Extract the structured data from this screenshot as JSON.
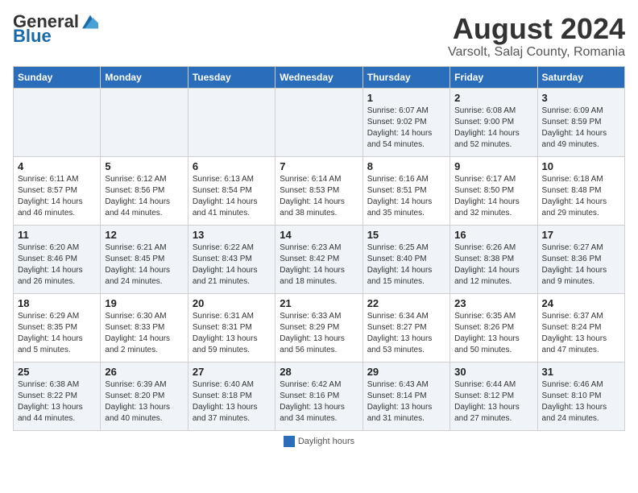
{
  "header": {
    "logo_general": "General",
    "logo_blue": "Blue",
    "main_title": "August 2024",
    "subtitle": "Varsolt, Salaj County, Romania"
  },
  "days_of_week": [
    "Sunday",
    "Monday",
    "Tuesday",
    "Wednesday",
    "Thursday",
    "Friday",
    "Saturday"
  ],
  "weeks": [
    [
      {
        "day": "",
        "info": ""
      },
      {
        "day": "",
        "info": ""
      },
      {
        "day": "",
        "info": ""
      },
      {
        "day": "",
        "info": ""
      },
      {
        "day": "1",
        "info": "Sunrise: 6:07 AM\nSunset: 9:02 PM\nDaylight: 14 hours\nand 54 minutes."
      },
      {
        "day": "2",
        "info": "Sunrise: 6:08 AM\nSunset: 9:00 PM\nDaylight: 14 hours\nand 52 minutes."
      },
      {
        "day": "3",
        "info": "Sunrise: 6:09 AM\nSunset: 8:59 PM\nDaylight: 14 hours\nand 49 minutes."
      }
    ],
    [
      {
        "day": "4",
        "info": "Sunrise: 6:11 AM\nSunset: 8:57 PM\nDaylight: 14 hours\nand 46 minutes."
      },
      {
        "day": "5",
        "info": "Sunrise: 6:12 AM\nSunset: 8:56 PM\nDaylight: 14 hours\nand 44 minutes."
      },
      {
        "day": "6",
        "info": "Sunrise: 6:13 AM\nSunset: 8:54 PM\nDaylight: 14 hours\nand 41 minutes."
      },
      {
        "day": "7",
        "info": "Sunrise: 6:14 AM\nSunset: 8:53 PM\nDaylight: 14 hours\nand 38 minutes."
      },
      {
        "day": "8",
        "info": "Sunrise: 6:16 AM\nSunset: 8:51 PM\nDaylight: 14 hours\nand 35 minutes."
      },
      {
        "day": "9",
        "info": "Sunrise: 6:17 AM\nSunset: 8:50 PM\nDaylight: 14 hours\nand 32 minutes."
      },
      {
        "day": "10",
        "info": "Sunrise: 6:18 AM\nSunset: 8:48 PM\nDaylight: 14 hours\nand 29 minutes."
      }
    ],
    [
      {
        "day": "11",
        "info": "Sunrise: 6:20 AM\nSunset: 8:46 PM\nDaylight: 14 hours\nand 26 minutes."
      },
      {
        "day": "12",
        "info": "Sunrise: 6:21 AM\nSunset: 8:45 PM\nDaylight: 14 hours\nand 24 minutes."
      },
      {
        "day": "13",
        "info": "Sunrise: 6:22 AM\nSunset: 8:43 PM\nDaylight: 14 hours\nand 21 minutes."
      },
      {
        "day": "14",
        "info": "Sunrise: 6:23 AM\nSunset: 8:42 PM\nDaylight: 14 hours\nand 18 minutes."
      },
      {
        "day": "15",
        "info": "Sunrise: 6:25 AM\nSunset: 8:40 PM\nDaylight: 14 hours\nand 15 minutes."
      },
      {
        "day": "16",
        "info": "Sunrise: 6:26 AM\nSunset: 8:38 PM\nDaylight: 14 hours\nand 12 minutes."
      },
      {
        "day": "17",
        "info": "Sunrise: 6:27 AM\nSunset: 8:36 PM\nDaylight: 14 hours\nand 9 minutes."
      }
    ],
    [
      {
        "day": "18",
        "info": "Sunrise: 6:29 AM\nSunset: 8:35 PM\nDaylight: 14 hours\nand 5 minutes."
      },
      {
        "day": "19",
        "info": "Sunrise: 6:30 AM\nSunset: 8:33 PM\nDaylight: 14 hours\nand 2 minutes."
      },
      {
        "day": "20",
        "info": "Sunrise: 6:31 AM\nSunset: 8:31 PM\nDaylight: 13 hours\nand 59 minutes."
      },
      {
        "day": "21",
        "info": "Sunrise: 6:33 AM\nSunset: 8:29 PM\nDaylight: 13 hours\nand 56 minutes."
      },
      {
        "day": "22",
        "info": "Sunrise: 6:34 AM\nSunset: 8:27 PM\nDaylight: 13 hours\nand 53 minutes."
      },
      {
        "day": "23",
        "info": "Sunrise: 6:35 AM\nSunset: 8:26 PM\nDaylight: 13 hours\nand 50 minutes."
      },
      {
        "day": "24",
        "info": "Sunrise: 6:37 AM\nSunset: 8:24 PM\nDaylight: 13 hours\nand 47 minutes."
      }
    ],
    [
      {
        "day": "25",
        "info": "Sunrise: 6:38 AM\nSunset: 8:22 PM\nDaylight: 13 hours\nand 44 minutes."
      },
      {
        "day": "26",
        "info": "Sunrise: 6:39 AM\nSunset: 8:20 PM\nDaylight: 13 hours\nand 40 minutes."
      },
      {
        "day": "27",
        "info": "Sunrise: 6:40 AM\nSunset: 8:18 PM\nDaylight: 13 hours\nand 37 minutes."
      },
      {
        "day": "28",
        "info": "Sunrise: 6:42 AM\nSunset: 8:16 PM\nDaylight: 13 hours\nand 34 minutes."
      },
      {
        "day": "29",
        "info": "Sunrise: 6:43 AM\nSunset: 8:14 PM\nDaylight: 13 hours\nand 31 minutes."
      },
      {
        "day": "30",
        "info": "Sunrise: 6:44 AM\nSunset: 8:12 PM\nDaylight: 13 hours\nand 27 minutes."
      },
      {
        "day": "31",
        "info": "Sunrise: 6:46 AM\nSunset: 8:10 PM\nDaylight: 13 hours\nand 24 minutes."
      }
    ]
  ],
  "footer": {
    "daylight_label": "Daylight hours"
  }
}
